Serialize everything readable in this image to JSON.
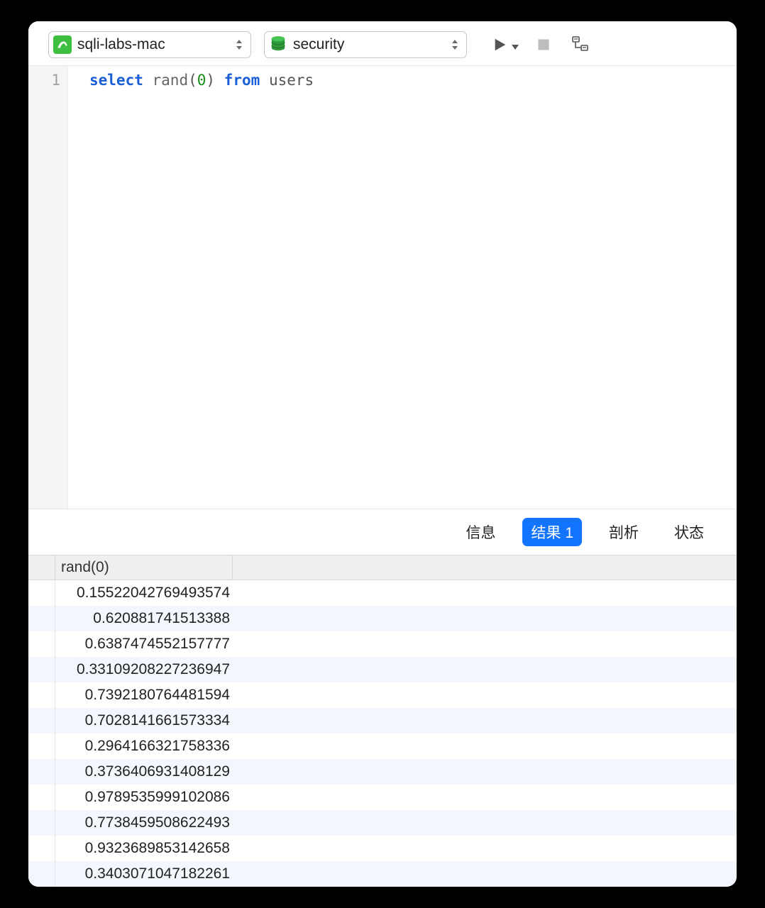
{
  "toolbar": {
    "connection": {
      "label": "sqli-labs-mac",
      "icon": "mysql-icon"
    },
    "database": {
      "label": "security",
      "icon": "database-icon"
    },
    "buttons": {
      "run": {
        "icon": "play-icon"
      },
      "stop": {
        "icon": "stop-icon"
      },
      "plan": {
        "icon": "explain-icon"
      }
    }
  },
  "editor": {
    "line_numbers": [
      "1"
    ],
    "query_tokens": [
      {
        "t": "select",
        "c": "kw"
      },
      {
        "t": " ",
        "c": ""
      },
      {
        "t": "rand",
        "c": "fn"
      },
      {
        "t": "(",
        "c": ""
      },
      {
        "t": "0",
        "c": "num"
      },
      {
        "t": ")",
        "c": ""
      },
      {
        "t": " ",
        "c": ""
      },
      {
        "t": "from",
        "c": "kw"
      },
      {
        "t": " ",
        "c": ""
      },
      {
        "t": "users",
        "c": ""
      }
    ]
  },
  "tabs": {
    "items": [
      {
        "label": "信息",
        "id": "tab-info"
      },
      {
        "label": "结果 1",
        "id": "tab-result",
        "active": true
      },
      {
        "label": "剖析",
        "id": "tab-profile"
      },
      {
        "label": "状态",
        "id": "tab-status"
      }
    ]
  },
  "results": {
    "columns": [
      "rand(0)"
    ],
    "rows": [
      "0.15522042769493574",
      "0.620881741513388",
      "0.6387474552157777",
      "0.33109208227236947",
      "0.7392180764481594",
      "0.7028141661573334",
      "0.2964166321758336",
      "0.3736406931408129",
      "0.9789535999102086",
      "0.7738459508622493",
      "0.9323689853142658",
      "0.3403071047182261"
    ]
  },
  "colors": {
    "accent": "#1374ff",
    "mysql_green": "#3fbf3f",
    "db_green": "#2e9a3a"
  }
}
